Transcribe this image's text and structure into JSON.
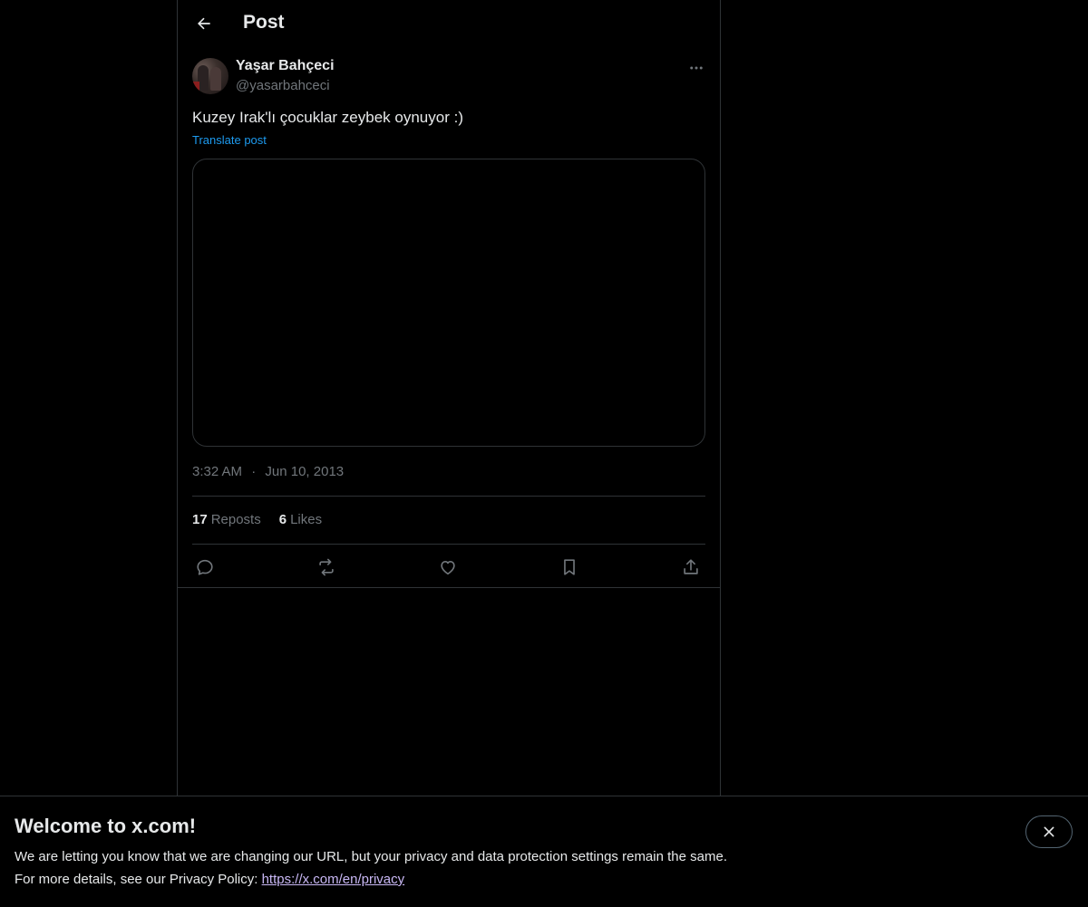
{
  "header": {
    "title": "Post",
    "back_icon": "arrow-left-icon"
  },
  "post": {
    "author": {
      "display_name": "Yaşar Bahçeci",
      "handle": "@yasarbahceci"
    },
    "text": "Kuzey Irak'lı çocuklar zeybek oynuyor :)",
    "translate_label": "Translate post",
    "time": "3:32 AM",
    "separator": "·",
    "date": "Jun 10, 2013",
    "stats": {
      "reposts_count": "17",
      "reposts_label": "Reposts",
      "likes_count": "6",
      "likes_label": "Likes"
    },
    "actions": [
      "reply-icon",
      "repost-icon",
      "like-icon",
      "bookmark-icon",
      "share-icon"
    ]
  },
  "banner": {
    "title": "Welcome to x.com!",
    "line1": "We are letting you know that we are changing our URL, but your privacy and data protection settings remain the same.",
    "line2_prefix": "For more details, see our Privacy Policy: ",
    "link_text": "https://x.com/en/privacy"
  },
  "colors": {
    "background": "#000000",
    "text": "#e7e9ea",
    "muted": "#71767b",
    "accent": "#1d9bf0",
    "border": "#2f3336"
  }
}
